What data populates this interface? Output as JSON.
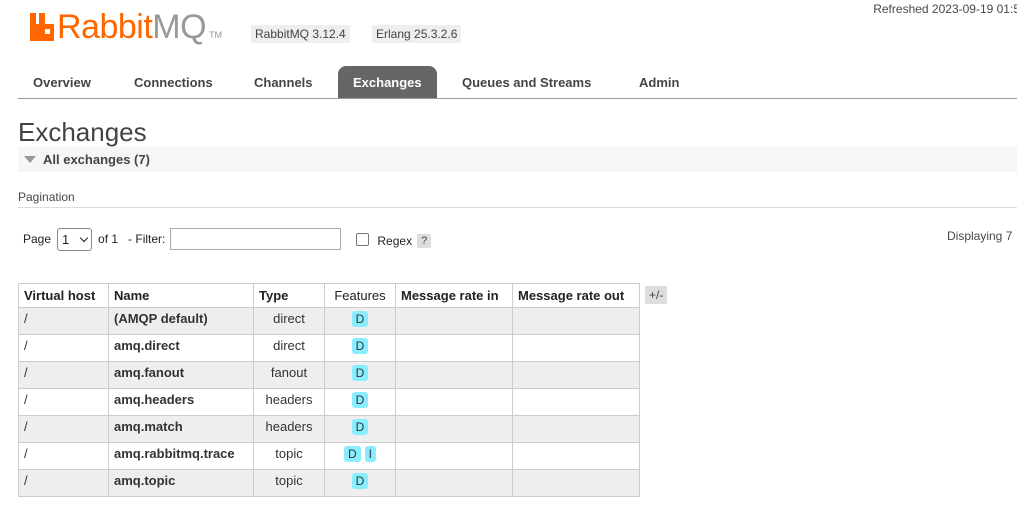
{
  "header": {
    "logo_rabbit": "Rabbit",
    "logo_mq": "MQ",
    "logo_tm": "TM",
    "rabbitmq_version": "RabbitMQ 3.12.4",
    "erlang_version": "Erlang 25.3.2.6",
    "refreshed": "Refreshed 2023-09-19 01:5"
  },
  "tabs": [
    {
      "label": "Overview"
    },
    {
      "label": "Connections"
    },
    {
      "label": "Channels"
    },
    {
      "label": "Exchanges",
      "active": true
    },
    {
      "label": "Queues and Streams"
    },
    {
      "label": "Admin"
    }
  ],
  "page_title": "Exchanges",
  "section_title": "All exchanges (7)",
  "pagination": {
    "label": "Pagination",
    "page_label": "Page",
    "page_value": "1",
    "of_label": "of 1",
    "filter_label": "- Filter:",
    "filter_value": "",
    "regex_label": "Regex",
    "help": "?",
    "displaying": "Displaying 7"
  },
  "table": {
    "columns": [
      "Virtual host",
      "Name",
      "Type",
      "Features",
      "Message rate in",
      "Message rate out"
    ],
    "plus_minus": "+/-",
    "rows": [
      {
        "vhost": "/",
        "name": "(AMQP default)",
        "type": "direct",
        "features": [
          "D"
        ],
        "rate_in": "",
        "rate_out": ""
      },
      {
        "vhost": "/",
        "name": "amq.direct",
        "type": "direct",
        "features": [
          "D"
        ],
        "rate_in": "",
        "rate_out": ""
      },
      {
        "vhost": "/",
        "name": "amq.fanout",
        "type": "fanout",
        "features": [
          "D"
        ],
        "rate_in": "",
        "rate_out": ""
      },
      {
        "vhost": "/",
        "name": "amq.headers",
        "type": "headers",
        "features": [
          "D"
        ],
        "rate_in": "",
        "rate_out": ""
      },
      {
        "vhost": "/",
        "name": "amq.match",
        "type": "headers",
        "features": [
          "D"
        ],
        "rate_in": "",
        "rate_out": ""
      },
      {
        "vhost": "/",
        "name": "amq.rabbitmq.trace",
        "type": "topic",
        "features": [
          "D",
          "I"
        ],
        "rate_in": "",
        "rate_out": ""
      },
      {
        "vhost": "/",
        "name": "amq.topic",
        "type": "topic",
        "features": [
          "D"
        ],
        "rate_in": "",
        "rate_out": ""
      }
    ]
  },
  "colors": {
    "brand_orange": "#ff6600",
    "active_tab": "#666666",
    "feature_badge": "#88eeff"
  }
}
